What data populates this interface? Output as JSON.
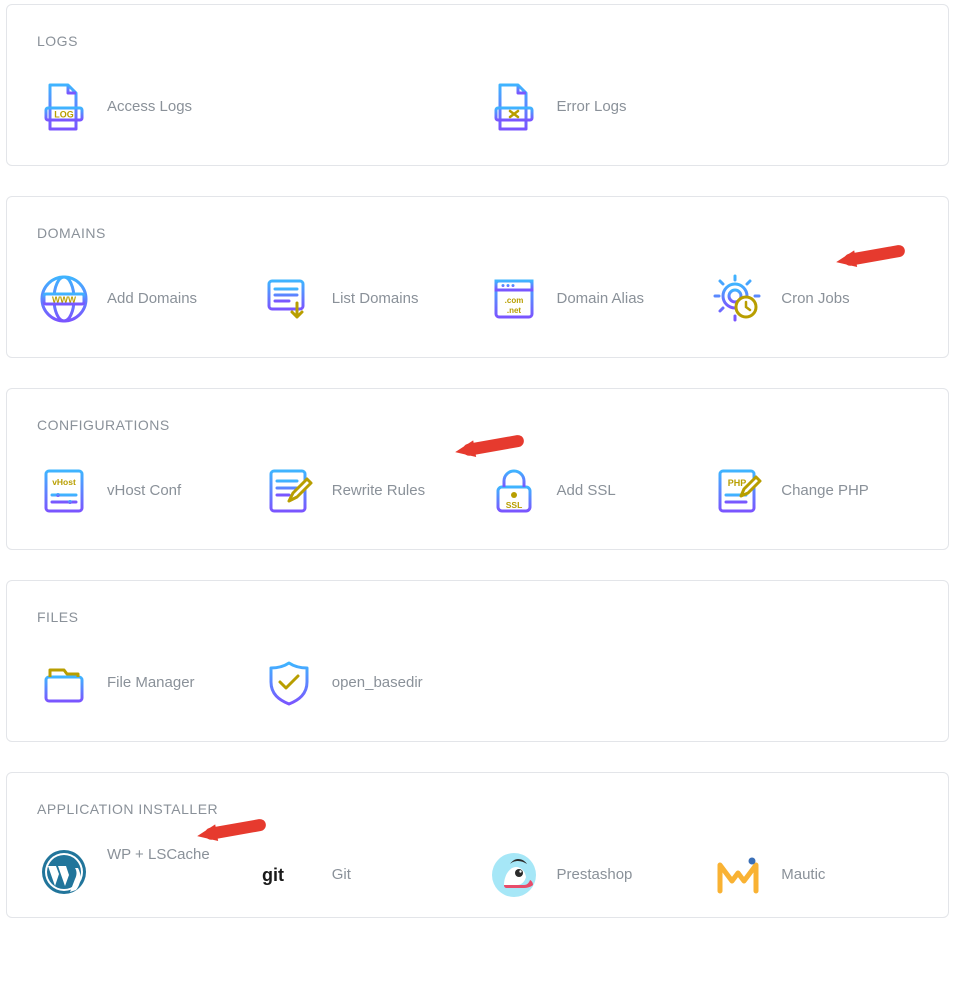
{
  "sections": {
    "logs": {
      "title": "LOGS",
      "items": {
        "access_logs": "Access Logs",
        "error_logs": "Error Logs"
      }
    },
    "domains": {
      "title": "DOMAINS",
      "items": {
        "add_domains": "Add Domains",
        "list_domains": "List Domains",
        "domain_alias": "Domain Alias",
        "cron_jobs": "Cron Jobs"
      }
    },
    "configurations": {
      "title": "CONFIGURATIONS",
      "items": {
        "vhost_conf": "vHost Conf",
        "rewrite_rules": "Rewrite Rules",
        "add_ssl": "Add SSL",
        "change_php": "Change PHP"
      }
    },
    "files": {
      "title": "FILES",
      "items": {
        "file_manager": "File Manager",
        "open_basedir": "open_basedir"
      }
    },
    "application_installer": {
      "title": "APPLICATION INSTALLER",
      "items": {
        "wp_lscache": "WP + LSCache",
        "git": "Git",
        "prestashop": "Prestashop",
        "mautic": "Mautic"
      }
    }
  },
  "annotations": {
    "arrows": [
      "cron_jobs_arrow",
      "add_ssl_arrow",
      "wp_lscache_arrow"
    ]
  }
}
